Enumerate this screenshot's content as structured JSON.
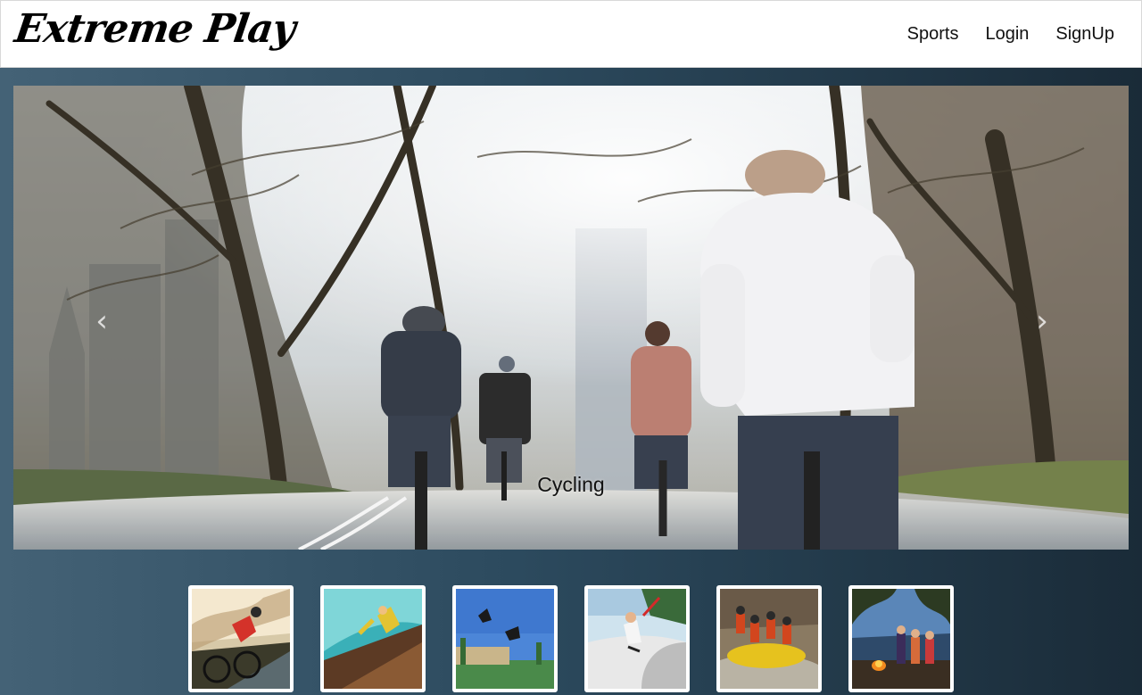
{
  "brand": {
    "name": "Extreme Play"
  },
  "nav": {
    "links": [
      {
        "label": "Sports"
      },
      {
        "label": "Login"
      },
      {
        "label": "SignUp"
      }
    ]
  },
  "carousel": {
    "caption": "Cycling",
    "prev_icon": "chevron-left-icon",
    "next_icon": "chevron-right-icon"
  },
  "thumbnails": [
    {
      "depicts": "road-cycling"
    },
    {
      "depicts": "skateboard-ramp"
    },
    {
      "depicts": "bmx-parkour-jumps"
    },
    {
      "depicts": "skatepark-trick"
    },
    {
      "depicts": "river-rafting"
    },
    {
      "depicts": "campfire-camping"
    }
  ]
}
